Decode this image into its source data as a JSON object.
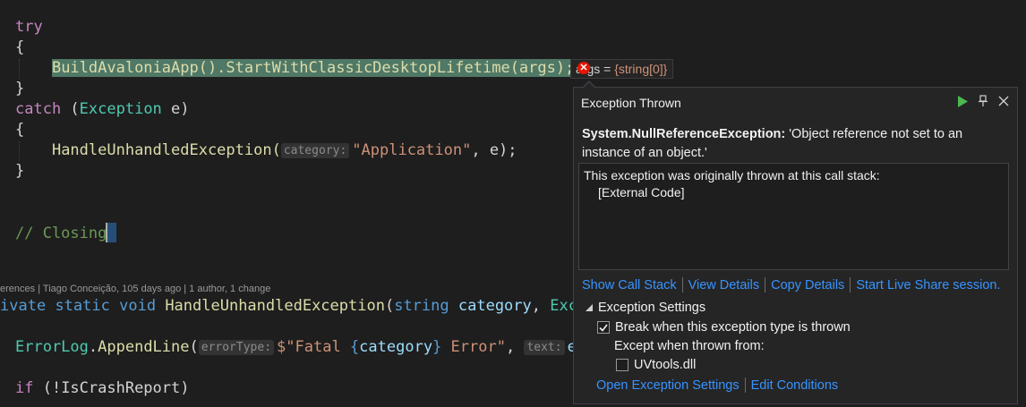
{
  "code": {
    "try_kw": "try",
    "brace_open_1": "{",
    "build_call": "BuildAvaloniaApp().StartWithClassicDesktopLifetime(args);",
    "brace_close_1": "}",
    "catch_kw": "catch",
    "catch_open": " (",
    "exception_type": "Exception",
    "catch_var": " e)",
    "brace_open_2": "{",
    "handle_fn": "HandleUnhandledException(",
    "category_hint": "category:",
    "application_str": "\"Application\"",
    "handle_rest": ", e);",
    "brace_close_2": "}",
    "comment": "// Closing",
    "codelens": "erences | Tiago Conceição, 105 days ago | 1 author, 1 change",
    "decl_private": "ivate",
    "decl_static": "static",
    "decl_void": "void",
    "decl_fn": "HandleUnhandledException",
    "decl_open": "(",
    "decl_string": "string",
    "decl_param": "category",
    "decl_comma": ", ",
    "decl_exc": "Excep",
    "errorlog_obj": "ErrorLog",
    "errorlog_dot": ".",
    "errorlog_fn": "AppendLine",
    "errorlog_open": "(",
    "errortype_hint": "errorType:",
    "fatal_str_1": "$\"Fatal ",
    "fatal_brace_open": "{",
    "fatal_var": "category",
    "fatal_brace_close": "}",
    "fatal_str_2": " Error\"",
    "fatal_comma": ", ",
    "text_hint": "text:",
    "fatal_tail": "ex",
    "if_kw": "if",
    "if_rest": " (!IsCrashReport)"
  },
  "datatip": {
    "name": "args",
    "eq": " = ",
    "value": "{string[0]}"
  },
  "popup": {
    "title": "Exception Thrown",
    "exception_type": "System.NullReferenceException:",
    "message": " 'Object reference not set to an instance of an object.'",
    "callstack_header": "This exception was originally thrown at this call stack:",
    "callstack_item": "[External Code]",
    "links": [
      "Show Call Stack",
      "View Details",
      "Copy Details",
      "Start Live Share session."
    ],
    "settings_label": "Exception Settings",
    "break_label": "Break when this exception type is thrown",
    "break_checked": true,
    "except_label": "Except when thrown from:",
    "module_label": "UVtools.dll",
    "module_checked": false,
    "bottom_links": [
      "Open Exception Settings",
      "Edit Conditions"
    ]
  },
  "icons": {
    "play": "play-icon",
    "pin": "pin-icon",
    "close": "close-icon",
    "error": "error-icon"
  }
}
